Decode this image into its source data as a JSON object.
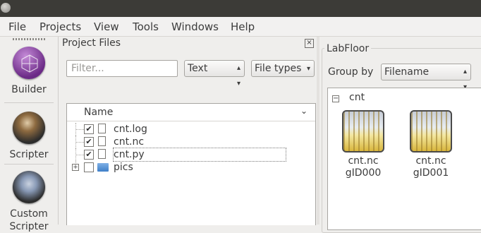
{
  "menubar": {
    "items": [
      {
        "label": "File"
      },
      {
        "label": "Projects"
      },
      {
        "label": "View"
      },
      {
        "label": "Tools"
      },
      {
        "label": "Windows"
      },
      {
        "label": "Help"
      }
    ]
  },
  "toolbar": {
    "tools": [
      {
        "label": "Builder",
        "icon": "builder-icon"
      },
      {
        "label": "Scripter",
        "icon": "scripter-icon"
      },
      {
        "label": "Custom Scripter",
        "icon": "custom-scripter-icon"
      }
    ]
  },
  "project_files": {
    "title": "Project Files",
    "filter_placeholder": "Filter...",
    "view_mode": "Text",
    "file_types": "File types",
    "column_name": "Name",
    "rows": [
      {
        "name": "cnt.log",
        "checked": "✔",
        "kind": "file"
      },
      {
        "name": "cnt.nc",
        "checked": "✔",
        "kind": "file"
      },
      {
        "name": "cnt.py",
        "checked": "✔",
        "kind": "file"
      },
      {
        "name": "pics",
        "checked": "",
        "kind": "folder"
      }
    ]
  },
  "labfloor": {
    "title": "LabFloor",
    "group_by_label": "Group by",
    "group_by_value": "Filename",
    "group_name": "cnt",
    "items": [
      {
        "line1": "cnt.nc",
        "line2": "gID000"
      },
      {
        "line1": "cnt.nc",
        "line2": "gID001"
      }
    ]
  }
}
